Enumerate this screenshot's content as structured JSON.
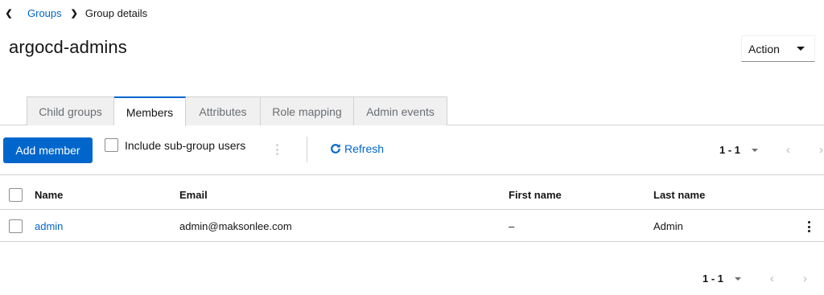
{
  "breadcrumb": {
    "items": [
      "Groups",
      "Group details"
    ]
  },
  "page": {
    "title": "argocd-admins"
  },
  "action_menu": {
    "label": "Action"
  },
  "tabs": [
    {
      "label": "Child groups",
      "active": false
    },
    {
      "label": "Members",
      "active": true
    },
    {
      "label": "Attributes",
      "active": false
    },
    {
      "label": "Role mapping",
      "active": false
    },
    {
      "label": "Admin events",
      "active": false
    }
  ],
  "toolbar": {
    "add_member_label": "Add member",
    "include_subgroup_label": "Include sub-group users",
    "include_subgroup_checked": false,
    "refresh_label": "Refresh"
  },
  "pagination": {
    "range": "1 - 1"
  },
  "table": {
    "columns": [
      "Name",
      "Email",
      "First name",
      "Last name"
    ],
    "rows": [
      {
        "name": "admin",
        "email": "admin@maksonlee.com",
        "first_name": "–",
        "last_name": "Admin"
      }
    ]
  },
  "colors": {
    "primary": "#0066cc",
    "border": "#d2d2d2",
    "tab_inactive_bg": "#f0f0f0"
  }
}
